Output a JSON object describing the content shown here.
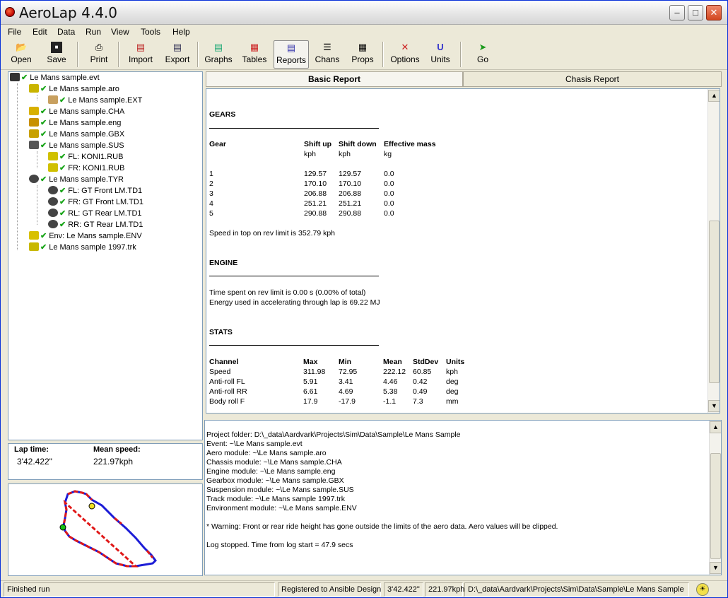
{
  "app": {
    "title": "AeroLap 4.4.0"
  },
  "menu": [
    "File",
    "Edit",
    "Data",
    "Run",
    "View",
    "Tools",
    "Help"
  ],
  "toolbar": {
    "open": "Open",
    "save": "Save",
    "print": "Print",
    "import": "Import",
    "export": "Export",
    "graphs": "Graphs",
    "tables": "Tables",
    "reports": "Reports",
    "chans": "Chans",
    "props": "Props",
    "options": "Options",
    "units": "Units",
    "go": "Go"
  },
  "tree": [
    {
      "label": "Le Mans sample.evt",
      "icon": "checkered-flag-icon"
    },
    {
      "label": "Le Mans sample.aro",
      "icon": "wing-icon"
    },
    {
      "label": "Le Mans sample.EXT",
      "icon": "extension-icon"
    },
    {
      "label": "Le Mans sample.CHA",
      "icon": "chassis-icon"
    },
    {
      "label": "Le Mans sample.eng",
      "icon": "engine-icon"
    },
    {
      "label": "Le Mans sample.GBX",
      "icon": "gearbox-icon"
    },
    {
      "label": "Le Mans sample.SUS",
      "icon": "spring-icon"
    },
    {
      "label": "FL: KONI1.RUB",
      "icon": "damper-icon"
    },
    {
      "label": "FR: KONI1.RUB",
      "icon": "damper-icon"
    },
    {
      "label": "Le Mans sample.TYR",
      "icon": "tyre-icon"
    },
    {
      "label": "FL: GT Front LM.TD1",
      "icon": "tyre-icon"
    },
    {
      "label": "FR: GT Front LM.TD1",
      "icon": "tyre-icon"
    },
    {
      "label": "RL: GT Rear LM.TD1",
      "icon": "tyre-icon"
    },
    {
      "label": "RR: GT Rear LM.TD1",
      "icon": "tyre-icon"
    },
    {
      "label": "Env: Le Mans sample.ENV",
      "icon": "cloud-icon"
    },
    {
      "label": "Le Mans sample 1997.trk",
      "icon": "track-icon"
    }
  ],
  "laptime": {
    "lap_label": "Lap time:",
    "lap_value": "3'42.422\"",
    "speed_label": "Mean speed:",
    "speed_value": "221.97kph"
  },
  "tabs": {
    "basic": "Basic Report",
    "chassis": "Chasis Report"
  },
  "report": {
    "gears_title": "GEARS",
    "gear_headers": [
      "Gear",
      "Shift up",
      "Shift down",
      "Effective mass"
    ],
    "gear_units": [
      "kph",
      "kph",
      "kg"
    ],
    "gears": [
      [
        "1",
        "129.57",
        "129.57",
        "0.0"
      ],
      [
        "2",
        "170.10",
        "170.10",
        "0.0"
      ],
      [
        "3",
        "206.88",
        "206.88",
        "0.0"
      ],
      [
        "4",
        "251.21",
        "251.21",
        "0.0"
      ],
      [
        "5",
        "290.88",
        "290.88",
        "0.0"
      ]
    ],
    "top_speed": "Speed in top on rev limit is 352.79 kph",
    "engine_title": "ENGINE",
    "engine_line1": "Time spent on rev limit is 0.00 s (0.00% of total)",
    "engine_line2": "Energy used in accelerating through lap is 69.22 MJ",
    "stats_title": "STATS",
    "stats_headers": [
      "Channel",
      "Max",
      "Min",
      "Mean",
      "StdDev",
      "Units"
    ],
    "stats": [
      [
        "Speed",
        "311.98",
        "72.95",
        "222.12",
        "60.85",
        "kph"
      ],
      [
        "Anti-roll FL",
        "5.91",
        "3.41",
        "4.46",
        "0.42",
        "deg"
      ],
      [
        "Anti-roll RR",
        "6.61",
        "4.69",
        "5.38",
        "0.49",
        "deg"
      ],
      [
        "Body roll F",
        "17.9",
        "-17.9",
        "-1.1",
        "7.3",
        "mm"
      ]
    ]
  },
  "log": [
    "Project folder: D:\\_data\\Aardvark\\Projects\\Sim\\Data\\Sample\\Le Mans Sample",
    "Event: ~\\Le Mans sample.evt",
    "Aero module: ~\\Le Mans sample.aro",
    "Chassis module: ~\\Le Mans sample.CHA",
    "Engine module: ~\\Le Mans sample.eng",
    "Gearbox module: ~\\Le Mans sample.GBX",
    "Suspension module: ~\\Le Mans sample.SUS",
    "Track module: ~\\Le Mans sample 1997.trk",
    "Environment module: ~\\Le Mans sample.ENV",
    "",
    "* Warning: Front or rear ride height has gone outside the limits of the aero data. Aero values will be clipped.",
    "",
    "Log stopped. Time from log start = 47.9 secs"
  ],
  "status": {
    "state": "Finished run",
    "registered": "Registered to Ansible Design",
    "laptime": "3'42.422\"",
    "speed": "221.97kph",
    "path": "D:\\_data\\Aardvark\\Projects\\Sim\\Data\\Sample\\Le Mans Sample"
  }
}
